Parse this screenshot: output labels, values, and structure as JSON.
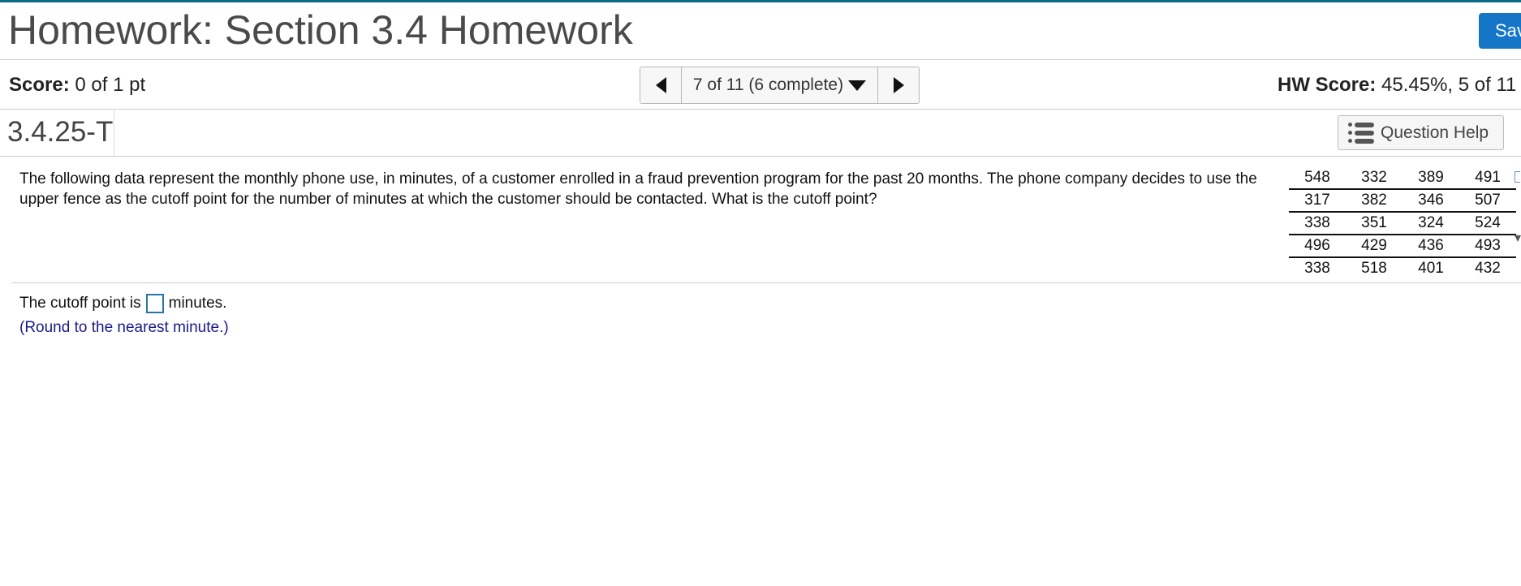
{
  "header": {
    "title": "Homework: Section 3.4 Homework",
    "save_label": "Sav"
  },
  "score_bar": {
    "score_label": "Score:",
    "score_value": "0 of 1 pt",
    "nav_position": "7 of 11 (6 complete)",
    "hw_score_label": "HW Score:",
    "hw_score_value": "45.45%, 5 of 11"
  },
  "question_bar": {
    "question_id": "3.4.25-T",
    "help_label": "Question Help"
  },
  "question": {
    "text": "The following data represent the monthly phone use, in minutes, of a customer enrolled in a fraud prevention program for the past 20 months. The phone company decides to use the upper fence as the cutoff point for the number of minutes at which the customer should be contacted. What is the cutoff point?",
    "data_rows": [
      [
        "548",
        "332",
        "389",
        "491"
      ],
      [
        "317",
        "382",
        "346",
        "507"
      ],
      [
        "338",
        "351",
        "324",
        "524"
      ],
      [
        "496",
        "429",
        "436",
        "493"
      ],
      [
        "338",
        "518",
        "401",
        "432"
      ]
    ]
  },
  "answer": {
    "prefix": "The cutoff point is",
    "input_value": "",
    "suffix": "minutes.",
    "hint": "(Round to the nearest minute.)"
  },
  "colors": {
    "top_accent": "#0e6b86",
    "primary_button": "#1576c8",
    "hint_text": "#1a1a8c",
    "input_border": "#2577a8"
  }
}
